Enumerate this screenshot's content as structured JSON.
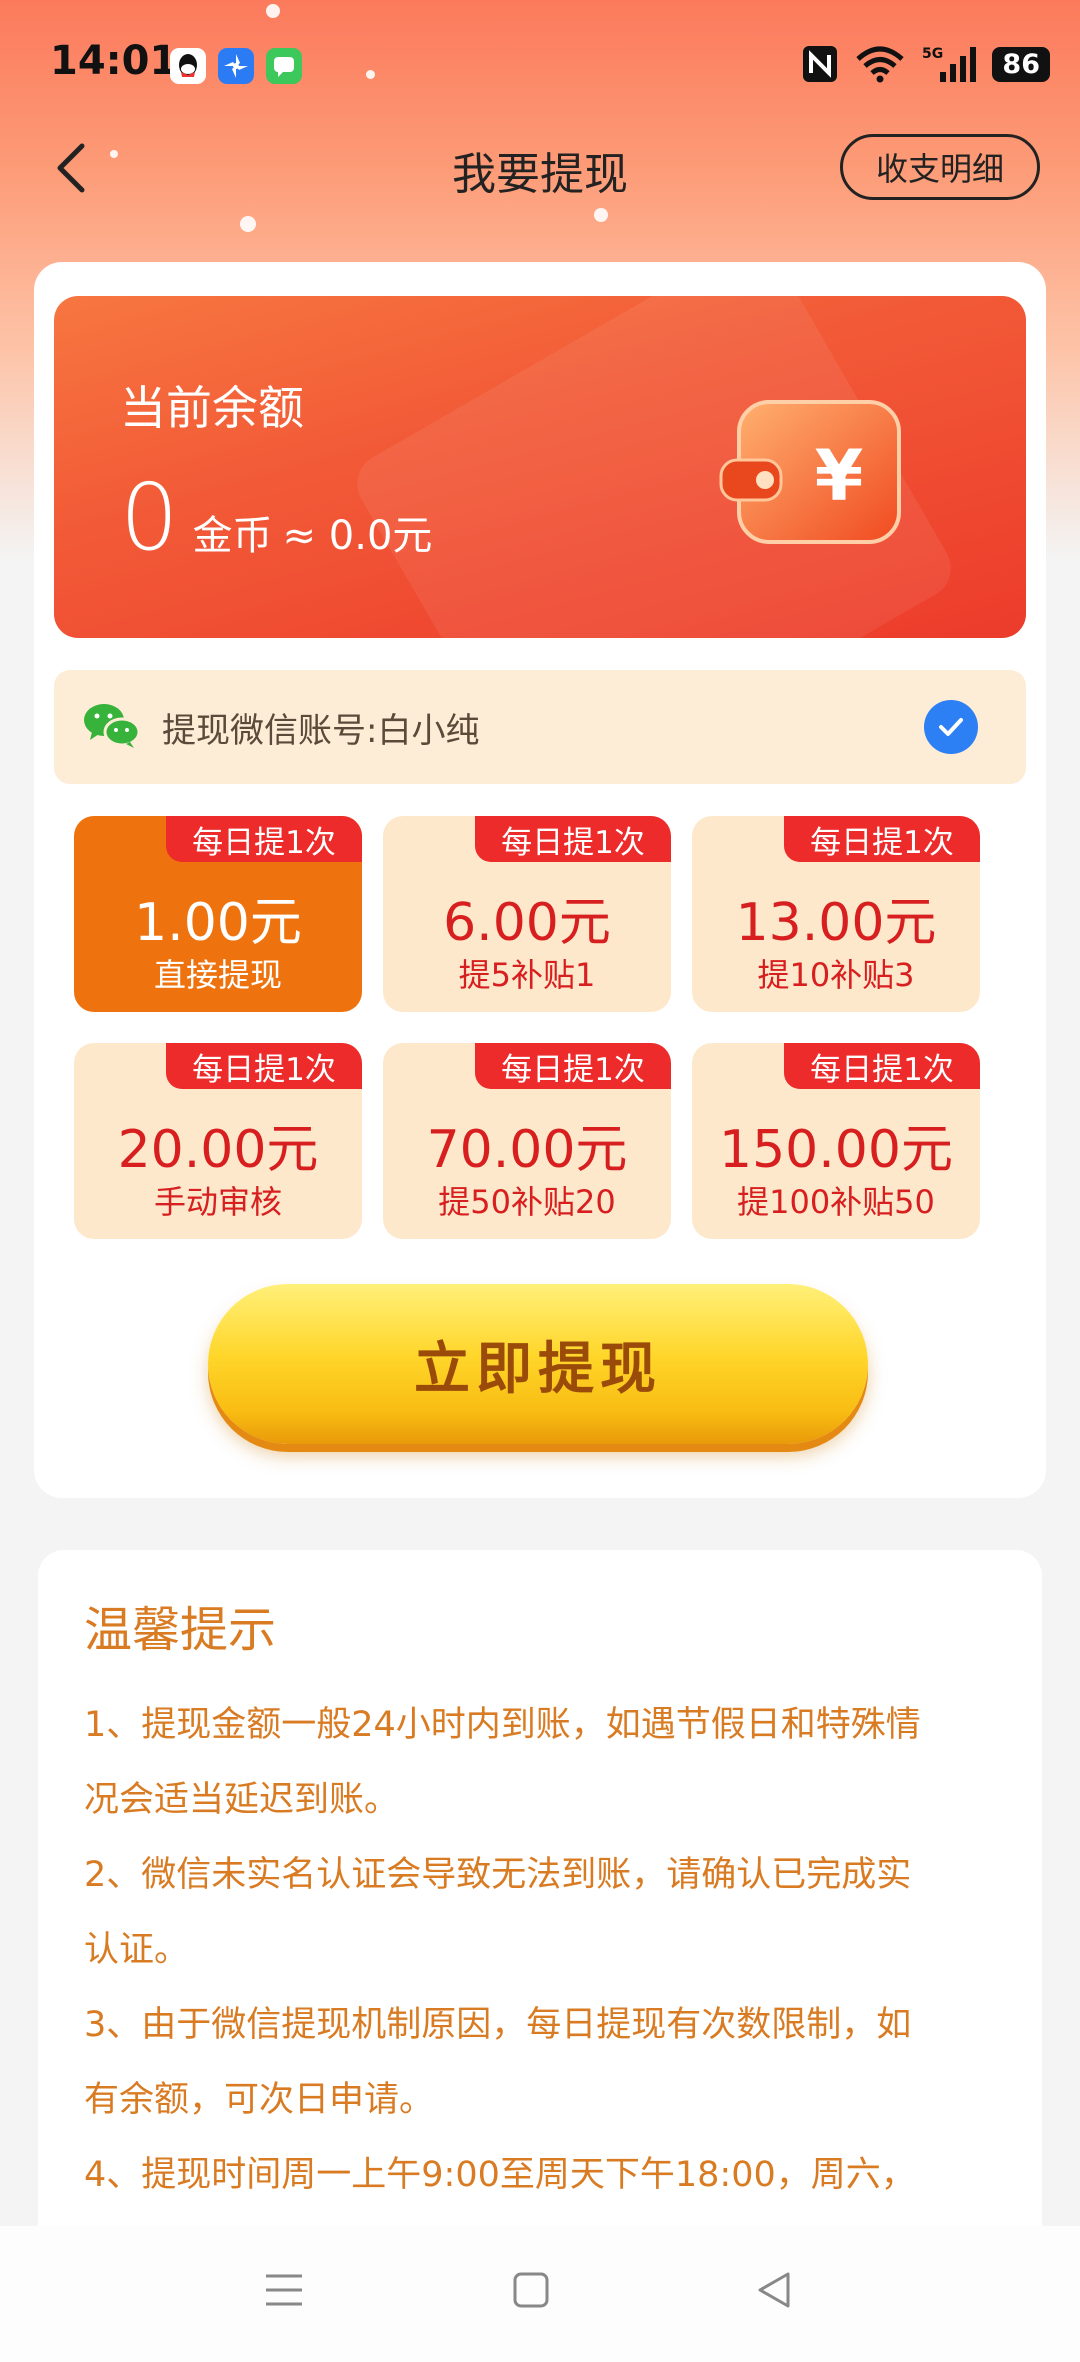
{
  "status_bar": {
    "time": "14:01",
    "battery": "86",
    "network": "5G"
  },
  "header": {
    "title": "我要提现",
    "detail_button": "收支明细"
  },
  "balance": {
    "label": "当前余额",
    "value": "0",
    "unit": "金币",
    "approx": "≈ 0.0元",
    "wallet_symbol": "¥"
  },
  "account": {
    "text": "提现微信账号:白小纯"
  },
  "options": [
    {
      "badge": "每日提1次",
      "amount": "1.00元",
      "sub": "直接提现",
      "selected": true
    },
    {
      "badge": "每日提1次",
      "amount": "6.00元",
      "sub": "提5补贴1",
      "selected": false
    },
    {
      "badge": "每日提1次",
      "amount": "13.00元",
      "sub": "提10补贴3",
      "selected": false
    },
    {
      "badge": "每日提1次",
      "amount": "20.00元",
      "sub": "手动审核",
      "selected": false
    },
    {
      "badge": "每日提1次",
      "amount": "70.00元",
      "sub": "提50补贴20",
      "selected": false
    },
    {
      "badge": "每日提1次",
      "amount": "150.00元",
      "sub": "提100补贴50",
      "selected": false
    }
  ],
  "withdraw_button": "立即提现",
  "tips": {
    "title": "温馨提示",
    "items": [
      "1、提现金额一般24小时内到账，如遇节假日和特殊情",
      "况会适当延迟到账。",
      "2、微信未实名认证会导致无法到账，请确认已完成实",
      "认证。",
      "3、由于微信提现机制原因，每日提现有次数限制，如",
      "有余额，可次日申请。",
      "4、提现时间周一上午9:00至周天下午18:00，周六，"
    ]
  },
  "colors": {
    "accent_orange": "#ee730e",
    "badge_red": "#ee2b2b",
    "amount_red": "#d81f1f",
    "tip_text": "#d97b22",
    "check_blue": "#2d7ff4"
  },
  "icons": [
    "back-arrow-icon",
    "qq-icon",
    "pinwheel-icon",
    "message-icon",
    "nfc-icon",
    "wifi-icon",
    "signal-icon",
    "battery-icon",
    "wallet-icon",
    "wechat-icon",
    "check-icon",
    "menu-icon",
    "home-icon",
    "back-triangle-icon"
  ]
}
